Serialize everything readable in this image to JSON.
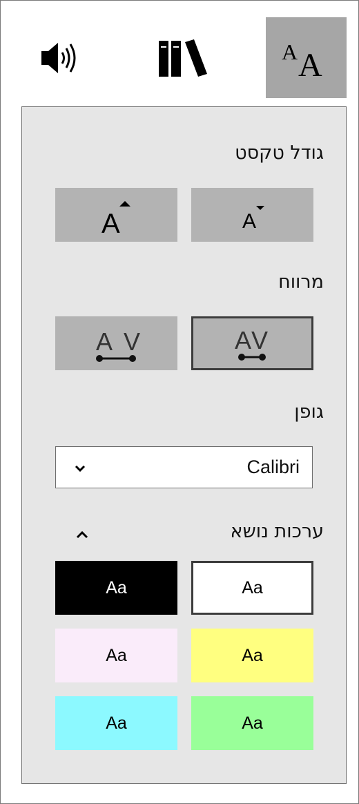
{
  "tabs": [
    {
      "name": "speaker-icon"
    },
    {
      "name": "library-icon"
    },
    {
      "name": "text-options-icon",
      "active": true
    }
  ],
  "text_size": {
    "label": "גודל טקסט"
  },
  "spacing": {
    "label": "מרווח"
  },
  "font": {
    "label": "גופן",
    "selected": "Calibri"
  },
  "themes": {
    "label": "ערכות נושא",
    "swatch_text": "Aa",
    "colors": {
      "white": "#ffffff",
      "black": "#000000",
      "yellow": "#ffff80",
      "lavender": "#faecfa",
      "green": "#99ff99",
      "cyan": "#8cf9ff"
    }
  }
}
